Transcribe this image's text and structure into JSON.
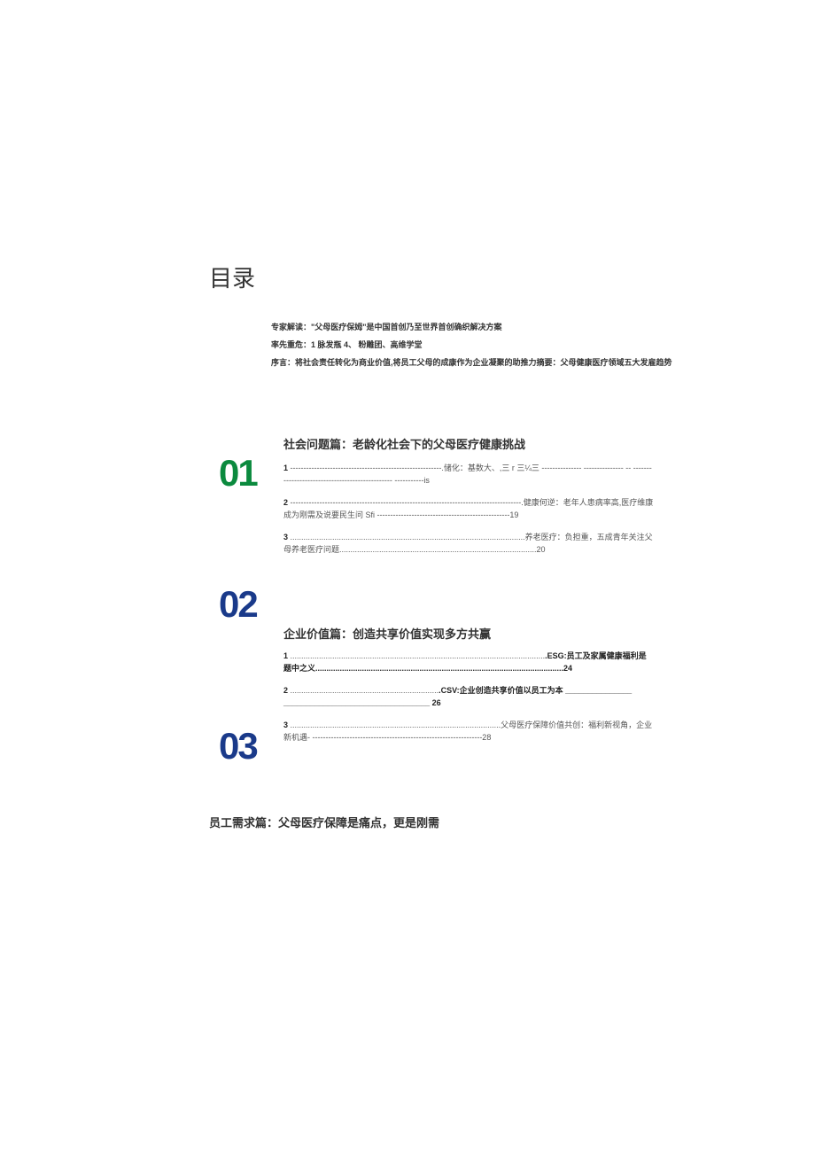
{
  "title": "目录",
  "intro": {
    "line1": "专家解读：\"父母医疗保姆\"是中国首创乃至世界首创确织解决方案",
    "line2": "率先重危：1 脉发瓶 4、 粉雕团、高维学堂",
    "line3": "序言：将社会责任转化为商业价值,将员工父母的成康作为企业凝聚的助推力摘要：父母健康医疗领域五大发雇趋势"
  },
  "sections": {
    "s01": {
      "num": "01",
      "title": "社会问题篇：老龄化社会下的父母医疗健康挑战",
      "items": [
        {
          "num": "1",
          "text": ".储化：基数大、,三 r 三¼三 --------------- --------------- -- ------------------------------------------------ -----------is"
        },
        {
          "num": "2",
          "text": ".健康何逆：老年人患病率高,医疗维康成为刚需及说要民生问 Sfi --------------------------------------------------19"
        },
        {
          "num": "3",
          "text": ".养老医疗：负担重，五成青年关注父母养老医疗问题.........................................................................................20"
        }
      ]
    },
    "s02": {
      "num": "02",
      "title": "企业价值篇：创造共享价值实现多方共赢",
      "items": [
        {
          "num": "1",
          "text": ".ESG:员工及家属健康福利是题中之义................................................................................................................24"
        },
        {
          "num": "2",
          "text": ".CSV:企业创造共享价值以员工为本 _______________ _________________________________ 26"
        },
        {
          "num": "3",
          "text": ".父母医疗保障价值共创：福利新视角，企业新机遇- ----------------------------------------------------------------28"
        }
      ]
    },
    "s03": {
      "num": "03",
      "title": "员工需求篇：父母医疗保障是痛点，更是刚需"
    }
  }
}
